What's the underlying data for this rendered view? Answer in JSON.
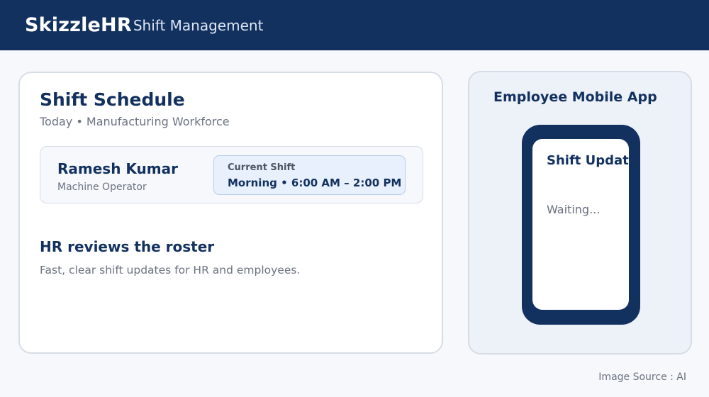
{
  "header": {
    "brand": "SkizzleHR",
    "subtitle": "Shift Management"
  },
  "schedule": {
    "title": "Shift Schedule",
    "subtitle": "Today • Manufacturing Workforce",
    "employee": {
      "name": "Ramesh Kumar",
      "role": "Machine Operator",
      "shift_label": "Current Shift",
      "shift_value": "Morning • 6:00 AM – 2:00 PM"
    },
    "review_title": "HR reviews the roster",
    "review_subtitle": "Fast, clear shift updates for HR and employees."
  },
  "mobile_app": {
    "title": "Employee Mobile App",
    "screen_title": "Shift Update",
    "screen_status": "Waiting..."
  },
  "footer": {
    "source": "Image Source : AI"
  },
  "colors": {
    "navy": "#13315f",
    "background": "#f6f8fc",
    "muted_text": "#6b7280",
    "shift_box": "#e7f0fc"
  }
}
